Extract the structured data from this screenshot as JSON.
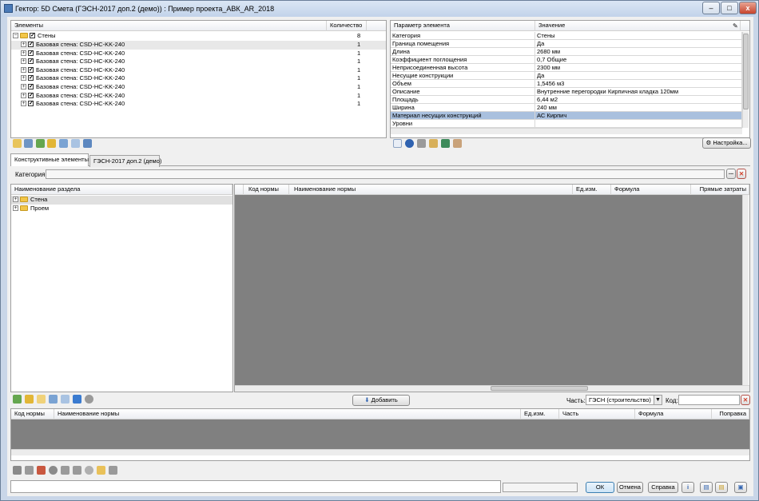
{
  "window": {
    "title": "Гектор: 5D Смета (ГЭСН-2017 доп.2 (демо)) : Пример проекта_АВК_AR_2018",
    "minimize": "–",
    "maximize": "□",
    "close": "x"
  },
  "elements_tree": {
    "col_elements": "Элементы",
    "col_count": "Количество",
    "root": {
      "label": "Стены",
      "count": "8"
    },
    "items": [
      {
        "label": "Базовая стена: CSD-HC-KK-240",
        "count": "1"
      },
      {
        "label": "Базовая стена: CSD-HC-KK-240",
        "count": "1"
      },
      {
        "label": "Базовая стена: CSD-HC-KK-240",
        "count": "1"
      },
      {
        "label": "Базовая стена: CSD-HC-KK-240",
        "count": "1"
      },
      {
        "label": "Базовая стена: CSD-HC-KK-240",
        "count": "1"
      },
      {
        "label": "Базовая стена: CSD-HC-KK-240",
        "count": "1"
      },
      {
        "label": "Базовая стена: CSD-HC-KK-240",
        "count": "1"
      },
      {
        "label": "Базовая стена: CSD-HC-KK-240",
        "count": "1"
      }
    ]
  },
  "params": {
    "col_param": "Параметр элемента",
    "col_value": "Значение",
    "rows": [
      {
        "name": "Категория",
        "value": "Стены"
      },
      {
        "name": "Граница помещения",
        "value": "Да"
      },
      {
        "name": "Длина",
        "value": "2680 мм"
      },
      {
        "name": "Коэффициент поглощения",
        "value": "0,7 Общие"
      },
      {
        "name": "Неприсоединенная высота",
        "value": "2300 мм"
      },
      {
        "name": "Несущие конструкции",
        "value": "Да"
      },
      {
        "name": "Объем",
        "value": "1,5456 м3"
      },
      {
        "name": "Описание",
        "value": "Внутренние перегородки Кирпичная кладка 120мм"
      },
      {
        "name": "Площадь",
        "value": "6,44 м2"
      },
      {
        "name": "Ширина",
        "value": "240 мм"
      },
      {
        "name": "Материал несущих конструкций",
        "value": "АС Кирпич"
      },
      {
        "name": "Уровни",
        "value": ""
      }
    ],
    "settings_button": "Настройка..."
  },
  "tabs": [
    {
      "label": "Конструктивные элементы"
    },
    {
      "label": "ГЭСН-2017 доп.2 (демо)"
    }
  ],
  "category": {
    "label": "Категория:",
    "value": "",
    "browse": "...",
    "clear": "✕"
  },
  "sections": {
    "header": "Наименование раздела",
    "items": [
      {
        "label": "Стена"
      },
      {
        "label": "Проем"
      }
    ]
  },
  "norms_top": {
    "columns": [
      "Код нормы",
      "Наименование нормы",
      "Ед.изм.",
      "Формула",
      "Прямые затраты"
    ]
  },
  "add_bar": {
    "add_button": "Добавить",
    "part_label": "Часть:",
    "part_value": "ГЭСН (строительство)",
    "code_label": "Код:",
    "code_value": ""
  },
  "norms_bottom": {
    "columns": [
      "Код нормы",
      "Наименование нормы",
      "Ед.изм.",
      "Часть",
      "Формула",
      "Поправка"
    ]
  },
  "footer": {
    "ok": "ОК",
    "cancel": "Отмена",
    "help": "Справка",
    "status": ""
  },
  "colors": {
    "titlebar": "#c2d3ea",
    "selection": "#a9c0de",
    "gray_area": "#808080",
    "close_red": "#d23b25"
  }
}
